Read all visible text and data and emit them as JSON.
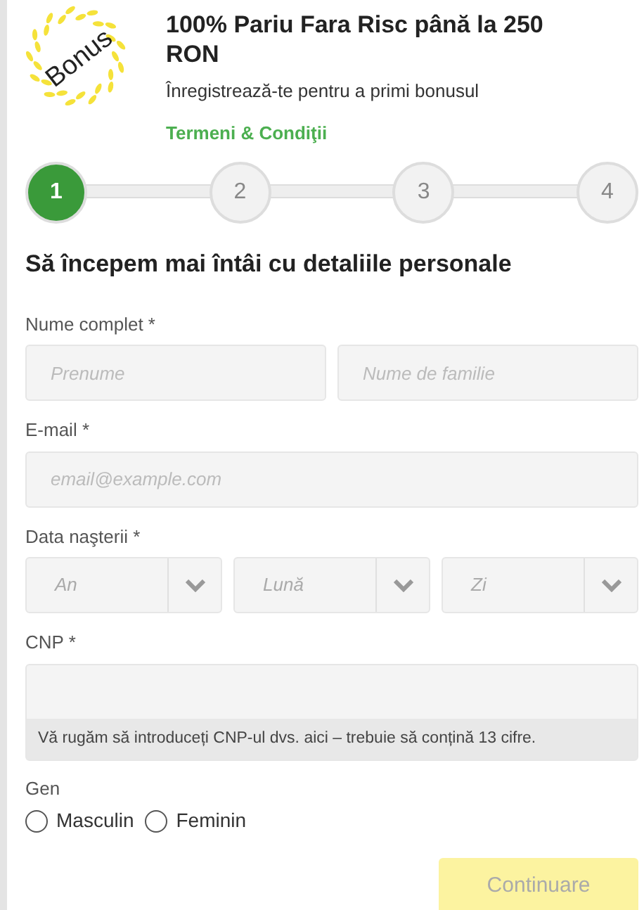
{
  "badge": {
    "text": "Bonus"
  },
  "offer": {
    "title": "100% Pariu Fara Risc până la 250 RON",
    "subtitle": "Înregistrează-te pentru a primi bonusul",
    "terms_link": "Termeni & Condiţii"
  },
  "steps": [
    {
      "label": "1",
      "selected": true
    },
    {
      "label": "2",
      "selected": false
    },
    {
      "label": "3",
      "selected": false
    },
    {
      "label": "4",
      "selected": false
    }
  ],
  "heading": "Să începem mai întâi cu detaliile personale",
  "full_name": {
    "label": "Nume complet *",
    "fields": [
      {
        "placeholder": "Prenume"
      },
      {
        "placeholder": "Nume de familie"
      }
    ]
  },
  "email": {
    "label": "E-mail *",
    "placeholder": "email@example.com"
  },
  "birth_date": {
    "label": "Data naşterii *",
    "selects": [
      {
        "placeholder": "An"
      },
      {
        "placeholder": "Lună"
      },
      {
        "placeholder": "Zi"
      }
    ]
  },
  "cnp": {
    "label": "CNP *",
    "hint": "Vă rugăm să introduceți CNP-ul dvs. aici – trebuie să conțină 13 cifre."
  },
  "gender": {
    "label": "Gen",
    "options": [
      {
        "label": "Masculin",
        "selected": false
      },
      {
        "label": "Feminin",
        "selected": false
      }
    ]
  },
  "continue_button": {
    "label": "Continuare",
    "disabled": true
  }
}
